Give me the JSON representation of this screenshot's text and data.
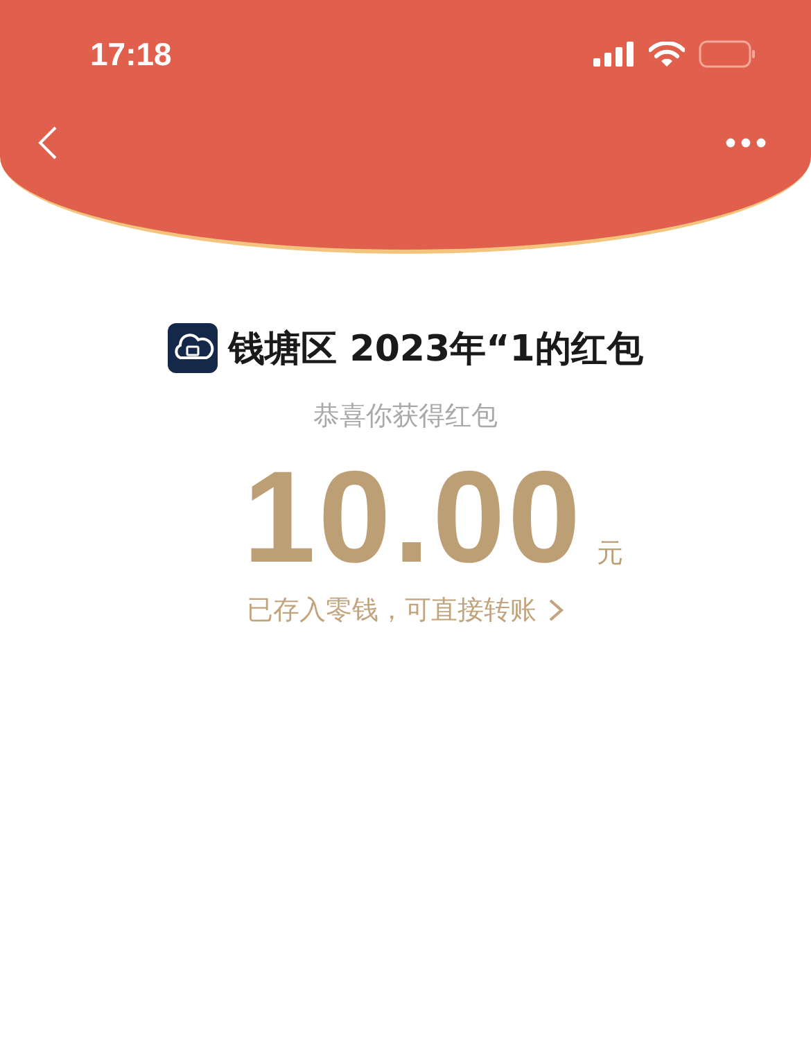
{
  "status_bar": {
    "time": "17:18"
  },
  "packet": {
    "title": "钱塘区 2023年“1的红包",
    "subtitle": "恭喜你获得红包",
    "amount": "10.00",
    "unit": "元",
    "link": "已存入零钱，可直接转账"
  }
}
